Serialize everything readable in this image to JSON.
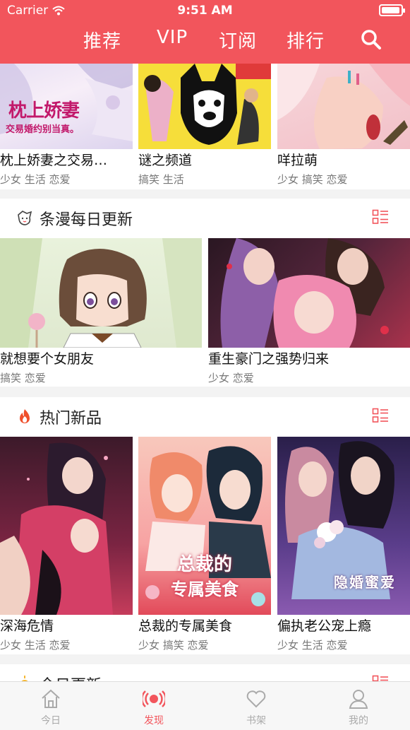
{
  "status": {
    "carrier": "Carrier",
    "time": "9:51 AM"
  },
  "header": {
    "tabs": [
      "推荐",
      "VIP",
      "订阅",
      "排行"
    ],
    "accent": "#f2555c"
  },
  "top_row": [
    {
      "title": "枕上娇妻之交易…",
      "tags": "少女 生活 恋爱",
      "cover_text": "枕上娇妻",
      "cover_sub": "交易婚约别当真。"
    },
    {
      "title": "谜之频道",
      "tags": "搞笑 生活"
    },
    {
      "title": "咩拉萌",
      "tags": "少女 搞笑 恋爱"
    }
  ],
  "section_daily": {
    "title": "条漫每日更新",
    "items": [
      {
        "title": "就想要个女朋友",
        "tags": "搞笑 恋爱"
      },
      {
        "title": "重生豪门之强势归来",
        "tags": "少女 恋爱"
      }
    ]
  },
  "section_hot": {
    "title": "热门新品",
    "items": [
      {
        "title": "深海危情",
        "tags": "少女 生活 恋爱"
      },
      {
        "title": "总裁的专属美食",
        "tags": "少女 搞笑 恋爱",
        "cover_text": "总裁的",
        "cover_sub": "专属美食"
      },
      {
        "title": "偏执老公宠上瘾",
        "tags": "少女 生活 恋爱",
        "cover_text": "隐婚蜜爱"
      }
    ]
  },
  "section_today": {
    "title": "今日更新"
  },
  "bottom_nav": [
    {
      "label": "今日",
      "active": false
    },
    {
      "label": "发现",
      "active": true
    },
    {
      "label": "书架",
      "active": false
    },
    {
      "label": "我的",
      "active": false
    }
  ]
}
